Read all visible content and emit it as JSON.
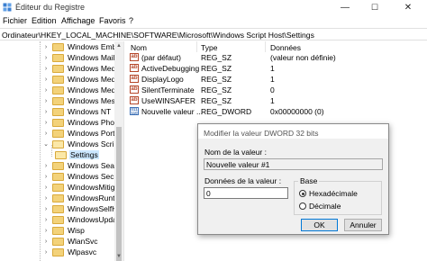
{
  "window": {
    "title": "Éditeur du Registre",
    "controls": {
      "minimize": "—",
      "maximize": "☐",
      "close": "✕"
    }
  },
  "menu": [
    "Fichier",
    "Edition",
    "Affichage",
    "Favoris",
    "?"
  ],
  "address": "Ordinateur\\HKEY_LOCAL_MACHINE\\SOFTWARE\\Microsoft\\Windows Script Host\\Settings",
  "tree": {
    "items": [
      {
        "label": "Windows Embedd"
      },
      {
        "label": "Windows Mail"
      },
      {
        "label": "Windows Media D"
      },
      {
        "label": "Windows Media F"
      },
      {
        "label": "Windows Media P"
      },
      {
        "label": "Windows Messag"
      },
      {
        "label": "Windows NT"
      },
      {
        "label": "Windows Photo V"
      },
      {
        "label": "Windows Portabl"
      },
      {
        "label": "Windows Script H"
      },
      {
        "label": "Settings"
      },
      {
        "label": "Windows Search"
      },
      {
        "label": "Windows Security"
      },
      {
        "label": "WindowsMitigati"
      },
      {
        "label": "WindowsRuntime"
      },
      {
        "label": "WindowsSelfHost"
      },
      {
        "label": "WindowsUpdate"
      },
      {
        "label": "Wisp"
      },
      {
        "label": "WlanSvc"
      },
      {
        "label": "Wlpasvc"
      }
    ]
  },
  "list": {
    "headers": {
      "name": "Nom",
      "type": "Type",
      "data": "Données"
    },
    "rows": [
      {
        "name": "(par défaut)",
        "type": "REG_SZ",
        "data": "(valeur non définie)",
        "icon": "string-value-icon"
      },
      {
        "name": "ActiveDebugging",
        "type": "REG_SZ",
        "data": "1",
        "icon": "string-value-icon"
      },
      {
        "name": "DisplayLogo",
        "type": "REG_SZ",
        "data": "1",
        "icon": "string-value-icon"
      },
      {
        "name": "SilentTerminate",
        "type": "REG_SZ",
        "data": "0",
        "icon": "string-value-icon"
      },
      {
        "name": "UseWINSAFER",
        "type": "REG_SZ",
        "data": "1",
        "icon": "string-value-icon"
      },
      {
        "name": "Nouvelle valeur ...",
        "type": "REG_DWORD",
        "data": "0x00000000 (0)",
        "icon": "binary-value-icon"
      }
    ]
  },
  "dialog": {
    "title": "Modifier la valeur DWORD 32 bits",
    "name_label": "Nom de la valeur :",
    "name_value": "Nouvelle valeur #1",
    "data_label": "Données de la valeur :",
    "data_value": "0",
    "base_label": "Base",
    "radio_hex": "Hexadécimale",
    "radio_dec": "Décimale",
    "ok": "OK",
    "cancel": "Annuler"
  }
}
